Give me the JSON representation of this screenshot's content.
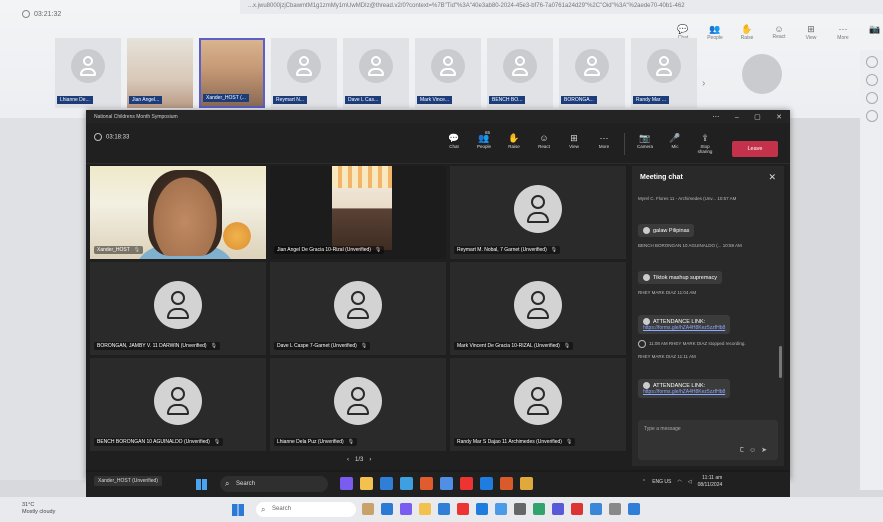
{
  "outer": {
    "url": "...x.jwu8000jzjCbawmtM1g1zmMy1mUwMDIz@thread.v2/0?context=%7B\"Tid\"%3A\"40e3ab80-2024-45e3-bf76-7a0761a24d29\"%2C\"Oid\"%3A\"%2aede70-40b1-462",
    "timer": "03:21:32",
    "toolbar": [
      {
        "icon": "chat-icon",
        "label": "Chat"
      },
      {
        "icon": "people-icon",
        "label": "People"
      },
      {
        "icon": "raise-hand-icon",
        "label": "Raise"
      },
      {
        "icon": "react-icon",
        "label": "React"
      },
      {
        "icon": "view-icon",
        "label": "View"
      },
      {
        "icon": "more-icon",
        "label": "More"
      },
      {
        "icon": "camera-icon",
        "label": ""
      }
    ],
    "strip": [
      {
        "name": "Lhianne De...",
        "photo": false,
        "selected": false
      },
      {
        "name": "Jian Angel...",
        "photo": true,
        "selected": false
      },
      {
        "name": "Xander_HOST (...",
        "photo": true,
        "selected": true
      },
      {
        "name": "Reymart N...",
        "photo": false,
        "selected": false
      },
      {
        "name": "Dave L Cas...",
        "photo": false,
        "selected": false
      },
      {
        "name": "Mark Vince...",
        "photo": false,
        "selected": false
      },
      {
        "name": "BENCH BO...",
        "photo": false,
        "selected": false
      },
      {
        "name": "BORONGA...",
        "photo": false,
        "selected": false
      },
      {
        "name": "Randy Mar ...",
        "photo": false,
        "selected": false
      }
    ]
  },
  "window": {
    "title": "National Childrens Month Symposium",
    "timer": "03:18:33",
    "toolbar": [
      {
        "icon": "chat-icon",
        "label": "Chat",
        "active": true
      },
      {
        "icon": "people-icon",
        "label": "People",
        "badge": "65"
      },
      {
        "icon": "raise-hand-icon",
        "label": "Raise"
      },
      {
        "icon": "react-icon",
        "label": "React"
      },
      {
        "icon": "view-icon",
        "label": "View"
      },
      {
        "icon": "more-icon",
        "label": "More"
      },
      {
        "icon": "camera-icon",
        "label": "Camera"
      },
      {
        "icon": "mic-icon",
        "label": "Mic"
      },
      {
        "icon": "share-icon",
        "label": "Stop sharing"
      }
    ],
    "leave_label": "Leave"
  },
  "participants": [
    {
      "name": "Xander_HOST",
      "type": "video1"
    },
    {
      "name": "Jian Angel De Gracia 10-Rizal (Unverified)",
      "type": "video2"
    },
    {
      "name": "Reymart M. Nobal, 7 Garnet (Unverified)",
      "type": "avatar"
    },
    {
      "name": "BORONGAN, JAMBY V. 11 DARWIN (Unverified)",
      "type": "avatar"
    },
    {
      "name": "Dave L Caspe 7-Garnet (Unverified)",
      "type": "avatar"
    },
    {
      "name": "Mark Vincent De Gracia 10-RIZAL (Unverified)",
      "type": "avatar"
    },
    {
      "name": "BENCH BORONGAN 10 AGUINALDO (Unverified)",
      "type": "avatar"
    },
    {
      "name": "Lhianne Dela Puz (Unverified)",
      "type": "avatar"
    },
    {
      "name": "Randy Mar S Dajao 11 Archimedes (Unverified)",
      "type": "avatar"
    }
  ],
  "pager": {
    "label": "1/3"
  },
  "chat": {
    "title": "Meeting chat",
    "messages": [
      {
        "meta": "Myrel C. Flores 11 - Archimedes (Unv... 10:57 AM",
        "text": "galaw Pilipinas",
        "link": ""
      },
      {
        "meta": "BENCH BORONGAN 10 AGUINALDO (... 10:59 AM",
        "text": "Tiktok mashup supremacy",
        "link": ""
      },
      {
        "meta": "RHEY MARK DIAZ 11:04 AM",
        "text": "ATTENDANCE LINK:",
        "link": "https://forms.gle/hZA4H8Kez5zzfHb8"
      },
      {
        "meta": "RHEY MARK DIAZ 11:11 AM",
        "text": "ATTENDANCE LINK:",
        "link": "https://forms.gle/hZA4H8Kez5zzfHb8"
      }
    ],
    "system": "11:08 AM   RHEY MARK DIAZ stopped recording.",
    "compose_placeholder": "Type a message"
  },
  "inner_taskbar": {
    "pill": "Xander_HOST (Unverified)",
    "search": "Search",
    "lang": "ENG\nUS",
    "time": "11:11 am",
    "date": "08/11/2024"
  },
  "outer_taskbar": {
    "temp": "31°C",
    "weather": "Mostly cloudy",
    "search": "Search"
  }
}
